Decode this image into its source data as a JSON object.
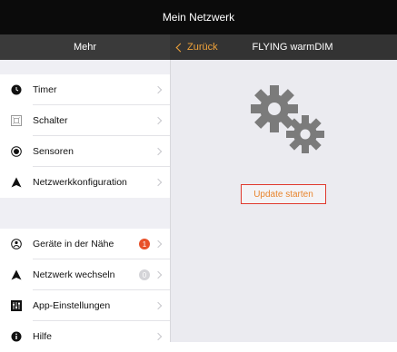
{
  "app": {
    "title": "Mein Netzwerk"
  },
  "sidebar": {
    "header": "Mehr",
    "items": [
      {
        "label": "Timer",
        "icon": "clock-icon"
      },
      {
        "label": "Schalter",
        "icon": "switch-icon"
      },
      {
        "label": "Sensoren",
        "icon": "sensor-icon"
      },
      {
        "label": "Netzwerkkonfiguration",
        "icon": "network-icon"
      }
    ],
    "items2": [
      {
        "label": "Geräte in der Nähe",
        "icon": "nearby-icon",
        "badge": "1"
      },
      {
        "label": "Netzwerk wechseln",
        "icon": "network-switch-icon",
        "badge": "0"
      },
      {
        "label": "App-Einstellungen",
        "icon": "settings-icon"
      },
      {
        "label": "Hilfe",
        "icon": "info-icon"
      }
    ]
  },
  "detail": {
    "back_label": "Zurück",
    "title": "FLYING warmDIM",
    "update_label": "Update starten"
  },
  "colors": {
    "accent": "#f0a33a",
    "update_border": "#e03a2f",
    "badge_red": "#e8512a"
  }
}
